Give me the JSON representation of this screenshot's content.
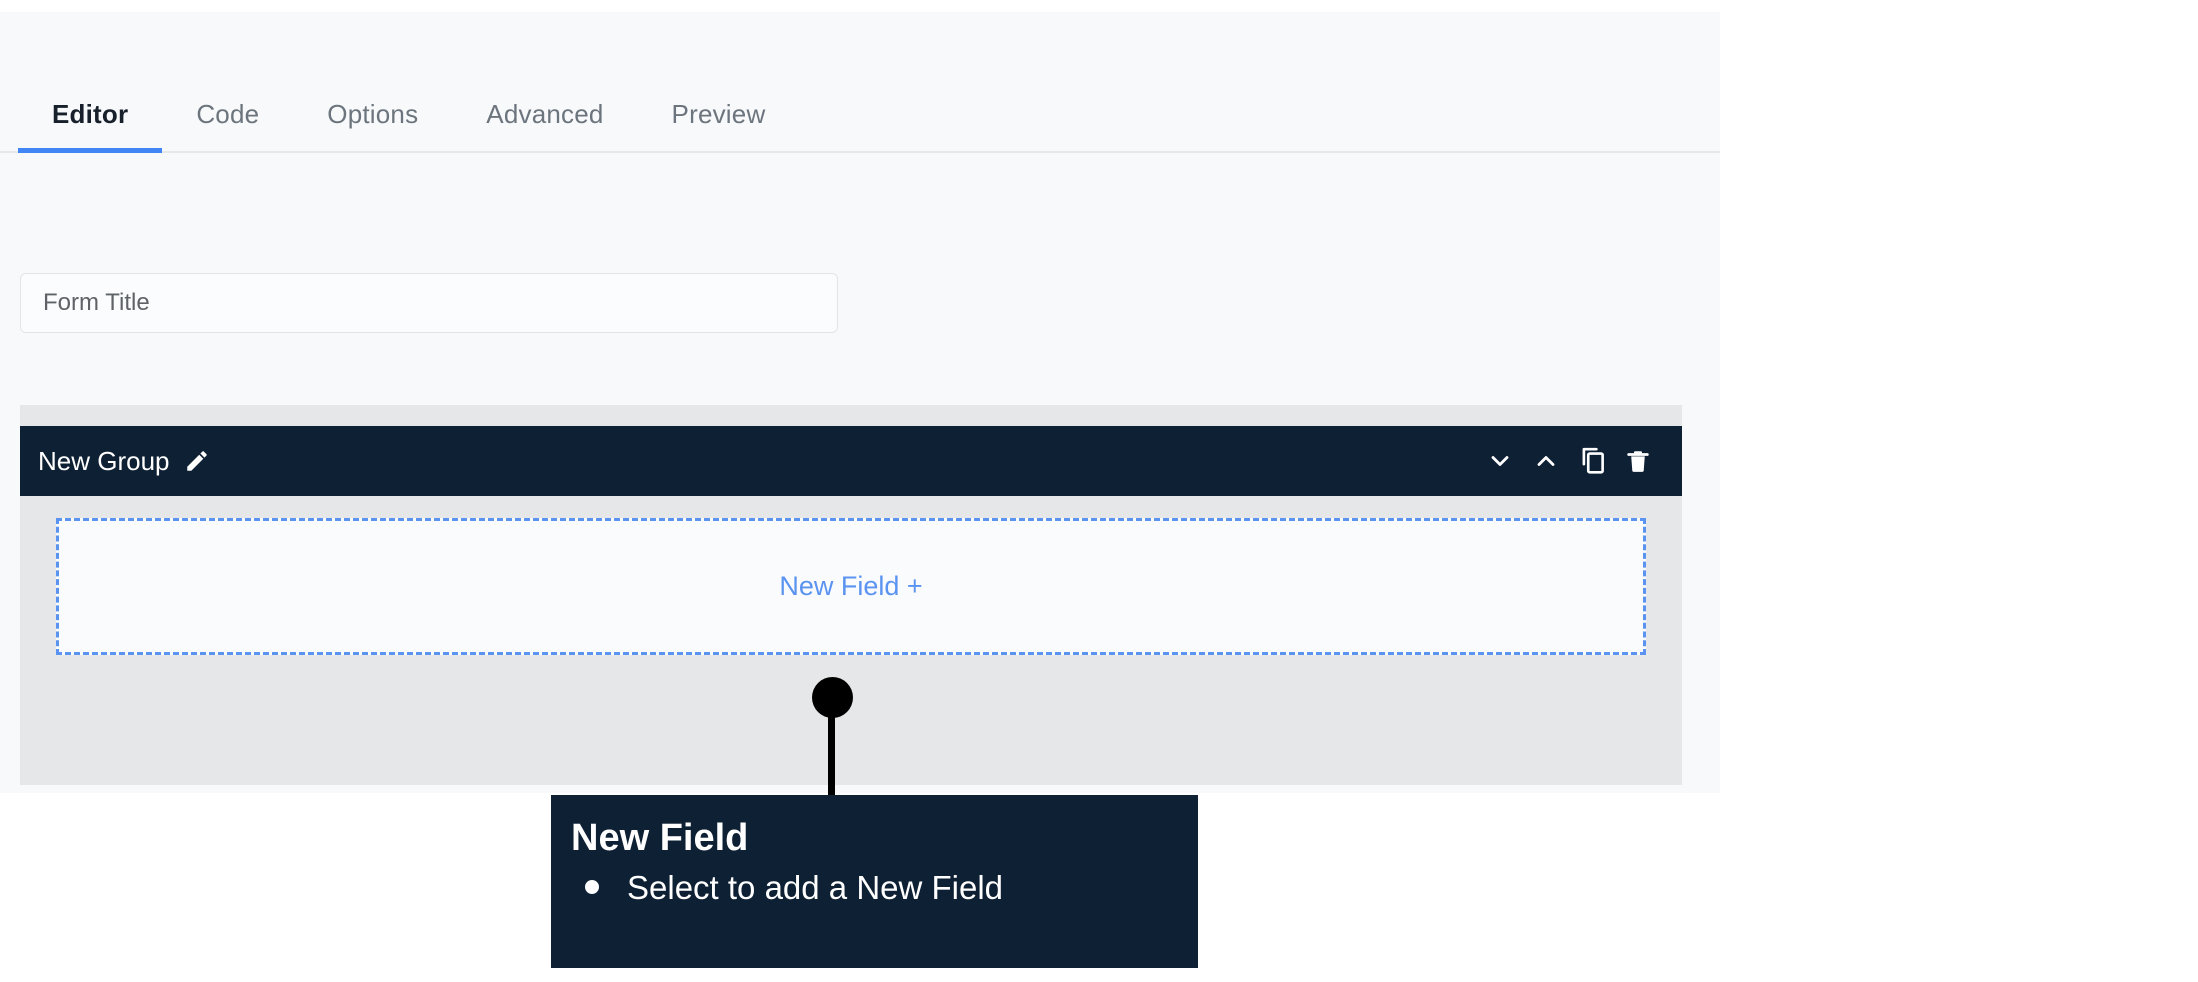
{
  "theme": {
    "page_bg": "#f8f9fb",
    "accent_blue": "#4285f4",
    "dashed_blue": "#5b93f0",
    "dark_navy": "#0e2034",
    "panel_gray": "#e6e7e9",
    "muted_text": "#6c757d"
  },
  "tabs": [
    {
      "label": "Editor",
      "active": true
    },
    {
      "label": "Code",
      "active": false
    },
    {
      "label": "Options",
      "active": false
    },
    {
      "label": "Advanced",
      "active": false
    },
    {
      "label": "Preview",
      "active": false
    }
  ],
  "form": {
    "title_input": {
      "value": "",
      "placeholder": "Form Title"
    }
  },
  "group": {
    "name": "New Group",
    "edit_icon": "pencil-icon",
    "actions": [
      {
        "name": "collapse-down",
        "icon": "chevron-down-icon"
      },
      {
        "name": "collapse-up",
        "icon": "chevron-up-icon"
      },
      {
        "name": "duplicate",
        "icon": "copy-icon"
      },
      {
        "name": "delete",
        "icon": "trash-icon"
      }
    ],
    "dropzone": {
      "label": "New Field +"
    }
  },
  "callout": {
    "title": "New Field",
    "items": [
      "Select to add a New Field"
    ]
  }
}
